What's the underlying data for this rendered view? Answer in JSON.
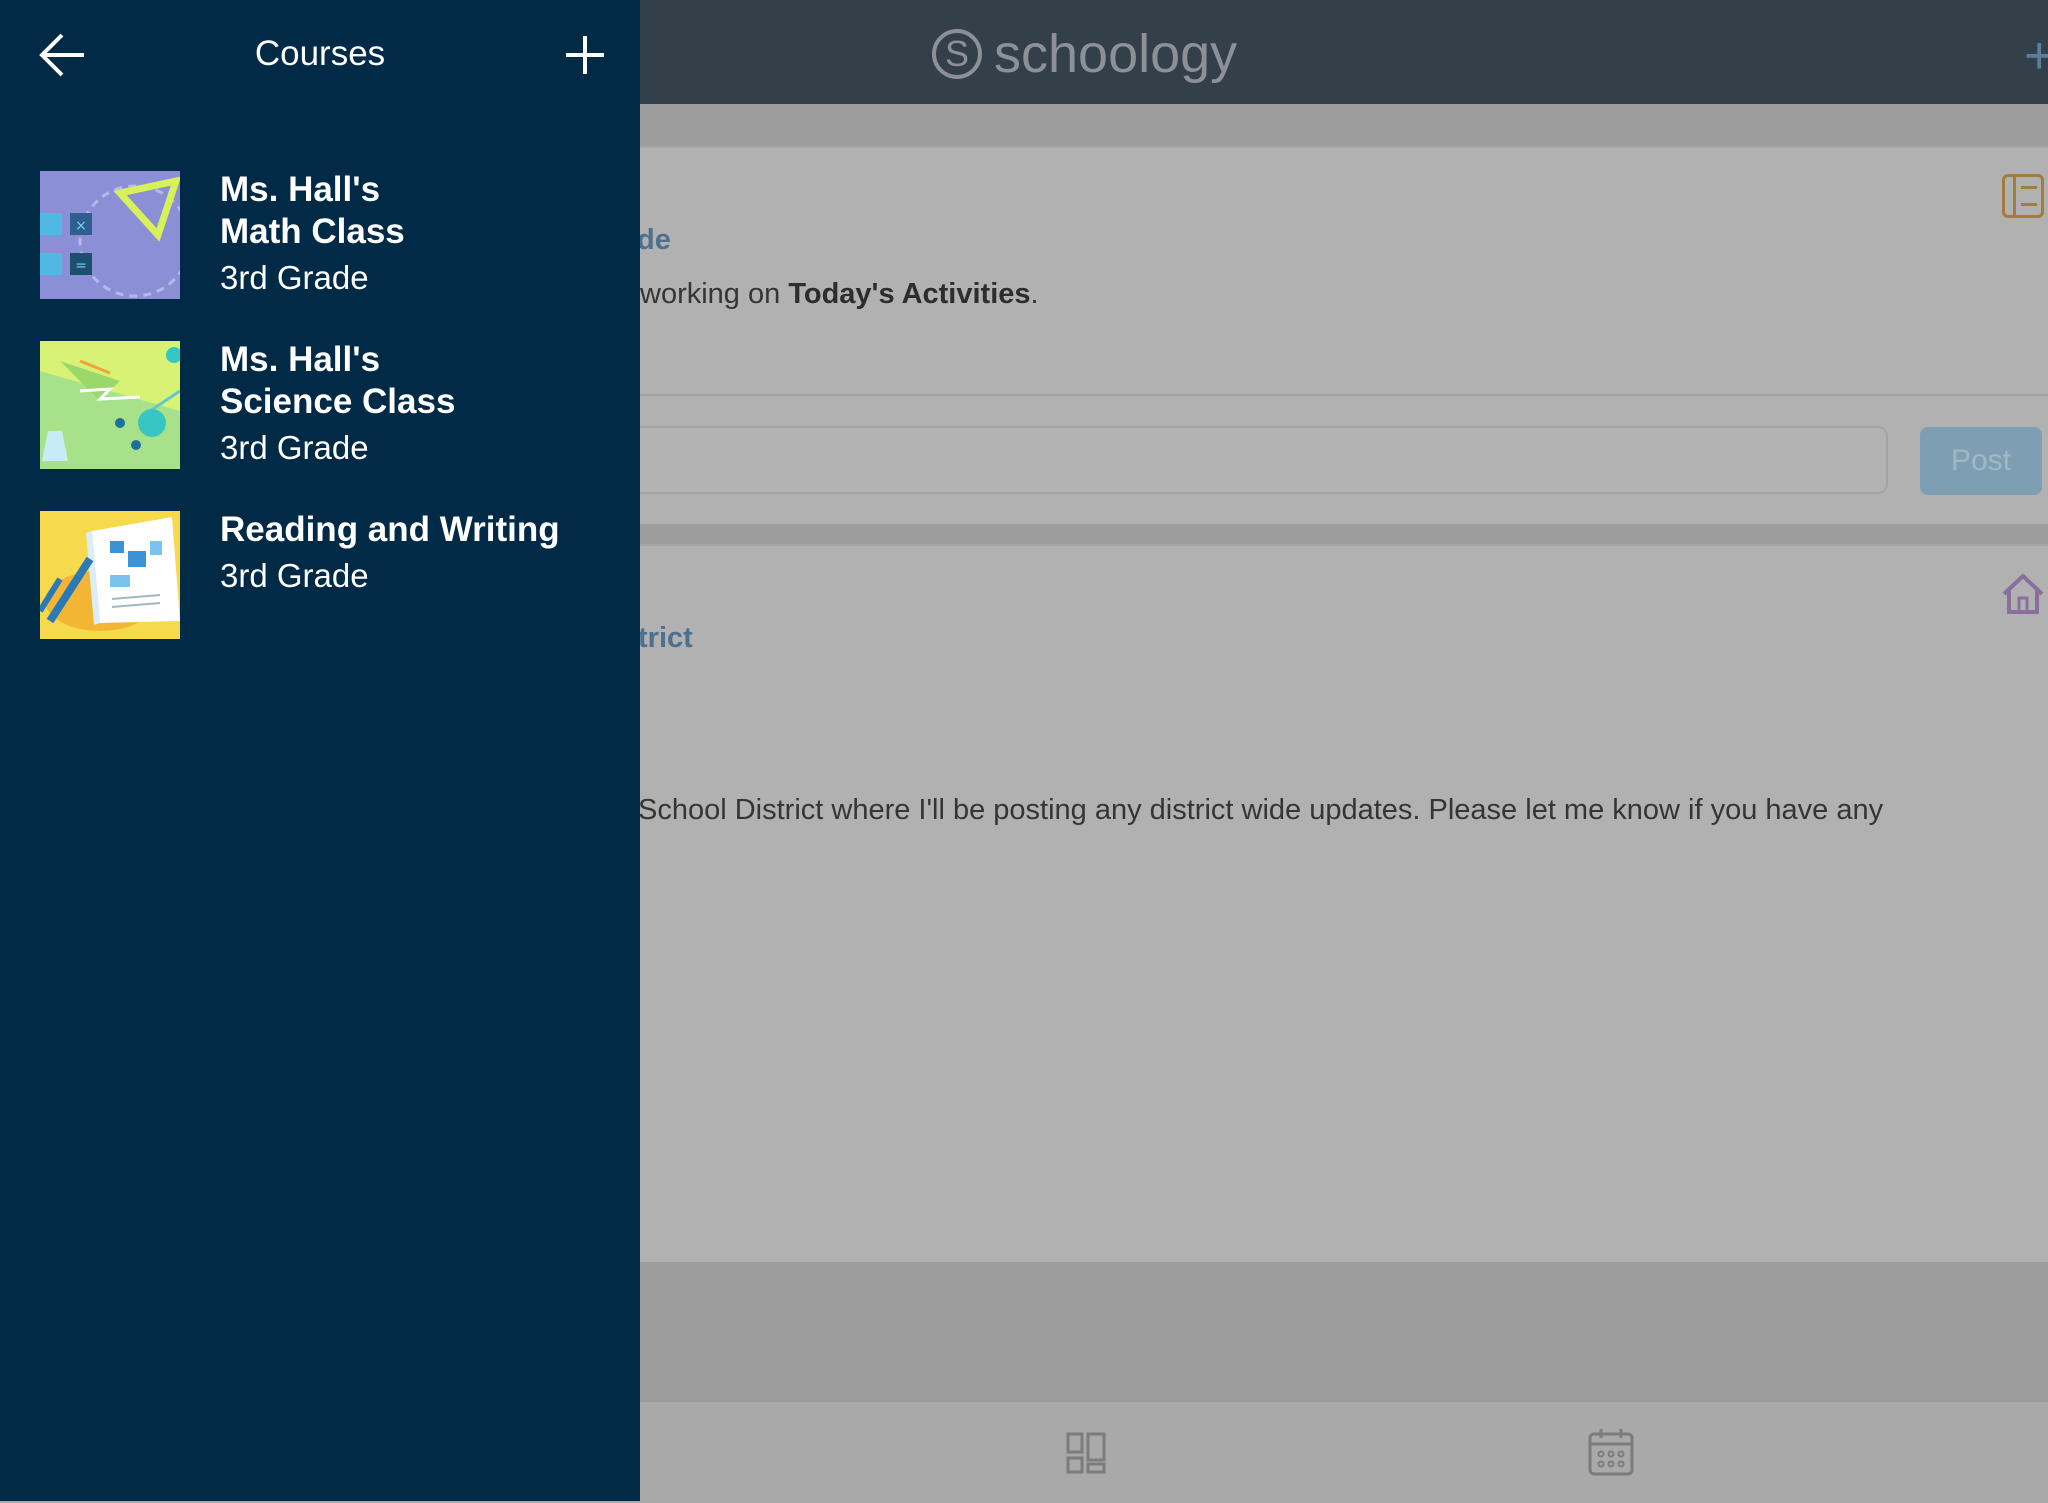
{
  "header": {
    "logo_text": "schoology",
    "logo_mark": "S"
  },
  "drawer": {
    "title": "Courses",
    "courses": [
      {
        "name": "Ms. Hall's Math Class",
        "name_line1": "Ms. Hall's",
        "name_line2": "Math Class",
        "grade": "3rd Grade",
        "thumb": "math-thumbnail"
      },
      {
        "name": "Ms. Hall's Science Class",
        "name_line1": "Ms. Hall's",
        "name_line2": "Science Class",
        "grade": "3rd Grade",
        "thumb": "science-thumbnail"
      },
      {
        "name": "Reading and Writing",
        "name_line1": "Reading and Writing",
        "grade": "3rd Grade",
        "thumb": "reading-thumbnail"
      }
    ]
  },
  "feed": {
    "card1": {
      "title_fragment": "de",
      "text_before": "working on ",
      "text_bold": "Today's Activities",
      "text_after": "."
    },
    "post": {
      "button_label": "Post",
      "input_placeholder": ""
    },
    "card2": {
      "title_fragment": "trict",
      "text": "School District where I'll be posting any district wide updates. Please let me know if you have any"
    }
  },
  "icons": [
    "back-arrow-icon",
    "plus-icon",
    "notebook-icon",
    "home-icon",
    "dashboard-icon",
    "calendar-icon"
  ],
  "colors": {
    "drawer_bg": "#012a47",
    "topbar_bg": "#333f49",
    "link_blue": "#4f6f8f",
    "post_button": "#7e9fb3"
  }
}
